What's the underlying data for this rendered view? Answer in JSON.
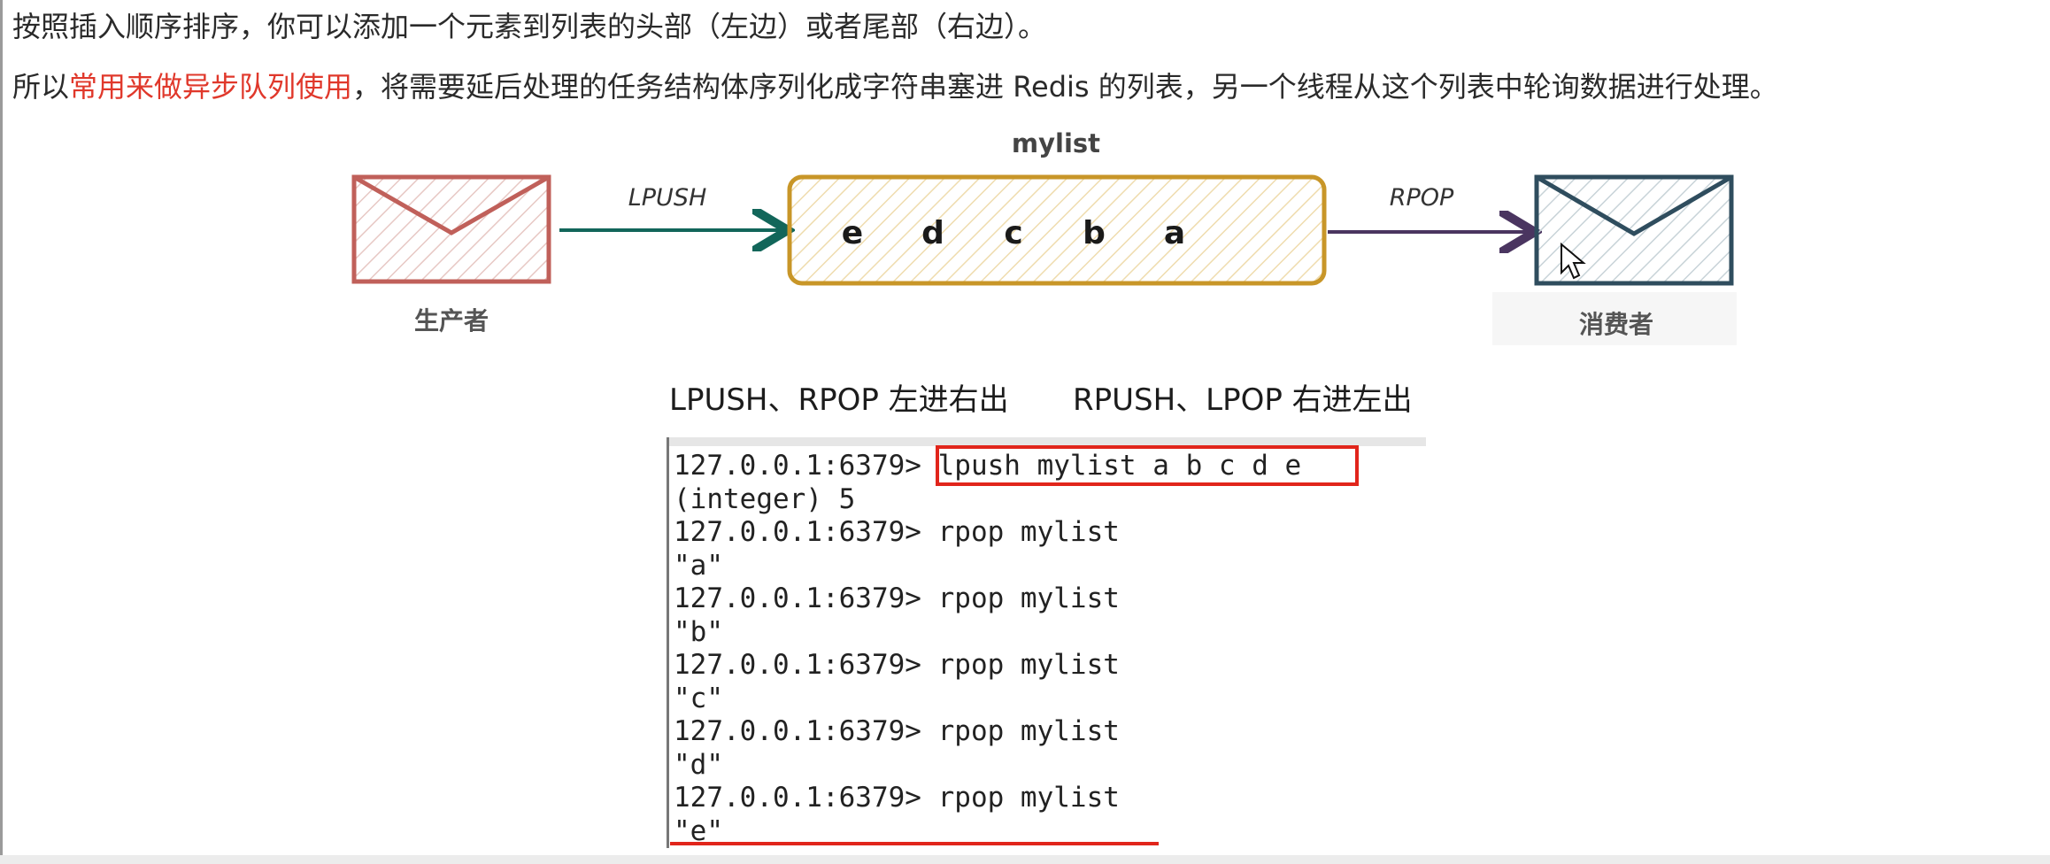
{
  "paragraphs": {
    "line1": "按照插入顺序排序，你可以添加一个元素到列表的头部（左边）或者尾部（右边）。",
    "line2_before": "所以",
    "line2_highlight": "常用来做异步队列使用",
    "line2_after": "，将需要延后处理的任务结构体序列化成字符串塞进 Redis 的列表，另一个线程从这个列表中轮询数据进行处理。"
  },
  "diagram": {
    "list_title": "mylist",
    "list_elements": [
      "e",
      "d",
      "c",
      "b",
      "a"
    ],
    "left_arrow_label": "LPUSH",
    "right_arrow_label": "RPOP",
    "producer_label": "生产者",
    "consumer_label": "消费者",
    "icons": {
      "producer": "envelope-icon",
      "consumer": "envelope-icon",
      "cursor": "mouse-cursor-icon"
    },
    "colors": {
      "producer": "#c0605a",
      "list_box": "#c89628",
      "consumer": "#2f4d5e",
      "left_arrow": "#12665a",
      "right_arrow": "#4a3560",
      "highlight": "#e0382b"
    }
  },
  "captions": {
    "left": "LPUSH、RPOP 左进右出",
    "right": "RPUSH、LPOP 右进左出"
  },
  "terminal": {
    "lines": [
      "127.0.0.1:6379> lpush mylist a b c d e",
      "(integer) 5",
      "127.0.0.1:6379> rpop mylist",
      "\"a\"",
      "127.0.0.1:6379> rpop mylist",
      "\"b\"",
      "127.0.0.1:6379> rpop mylist",
      "\"c\"",
      "127.0.0.1:6379> rpop mylist",
      "\"d\"",
      "127.0.0.1:6379> rpop mylist",
      "\"e\""
    ]
  }
}
